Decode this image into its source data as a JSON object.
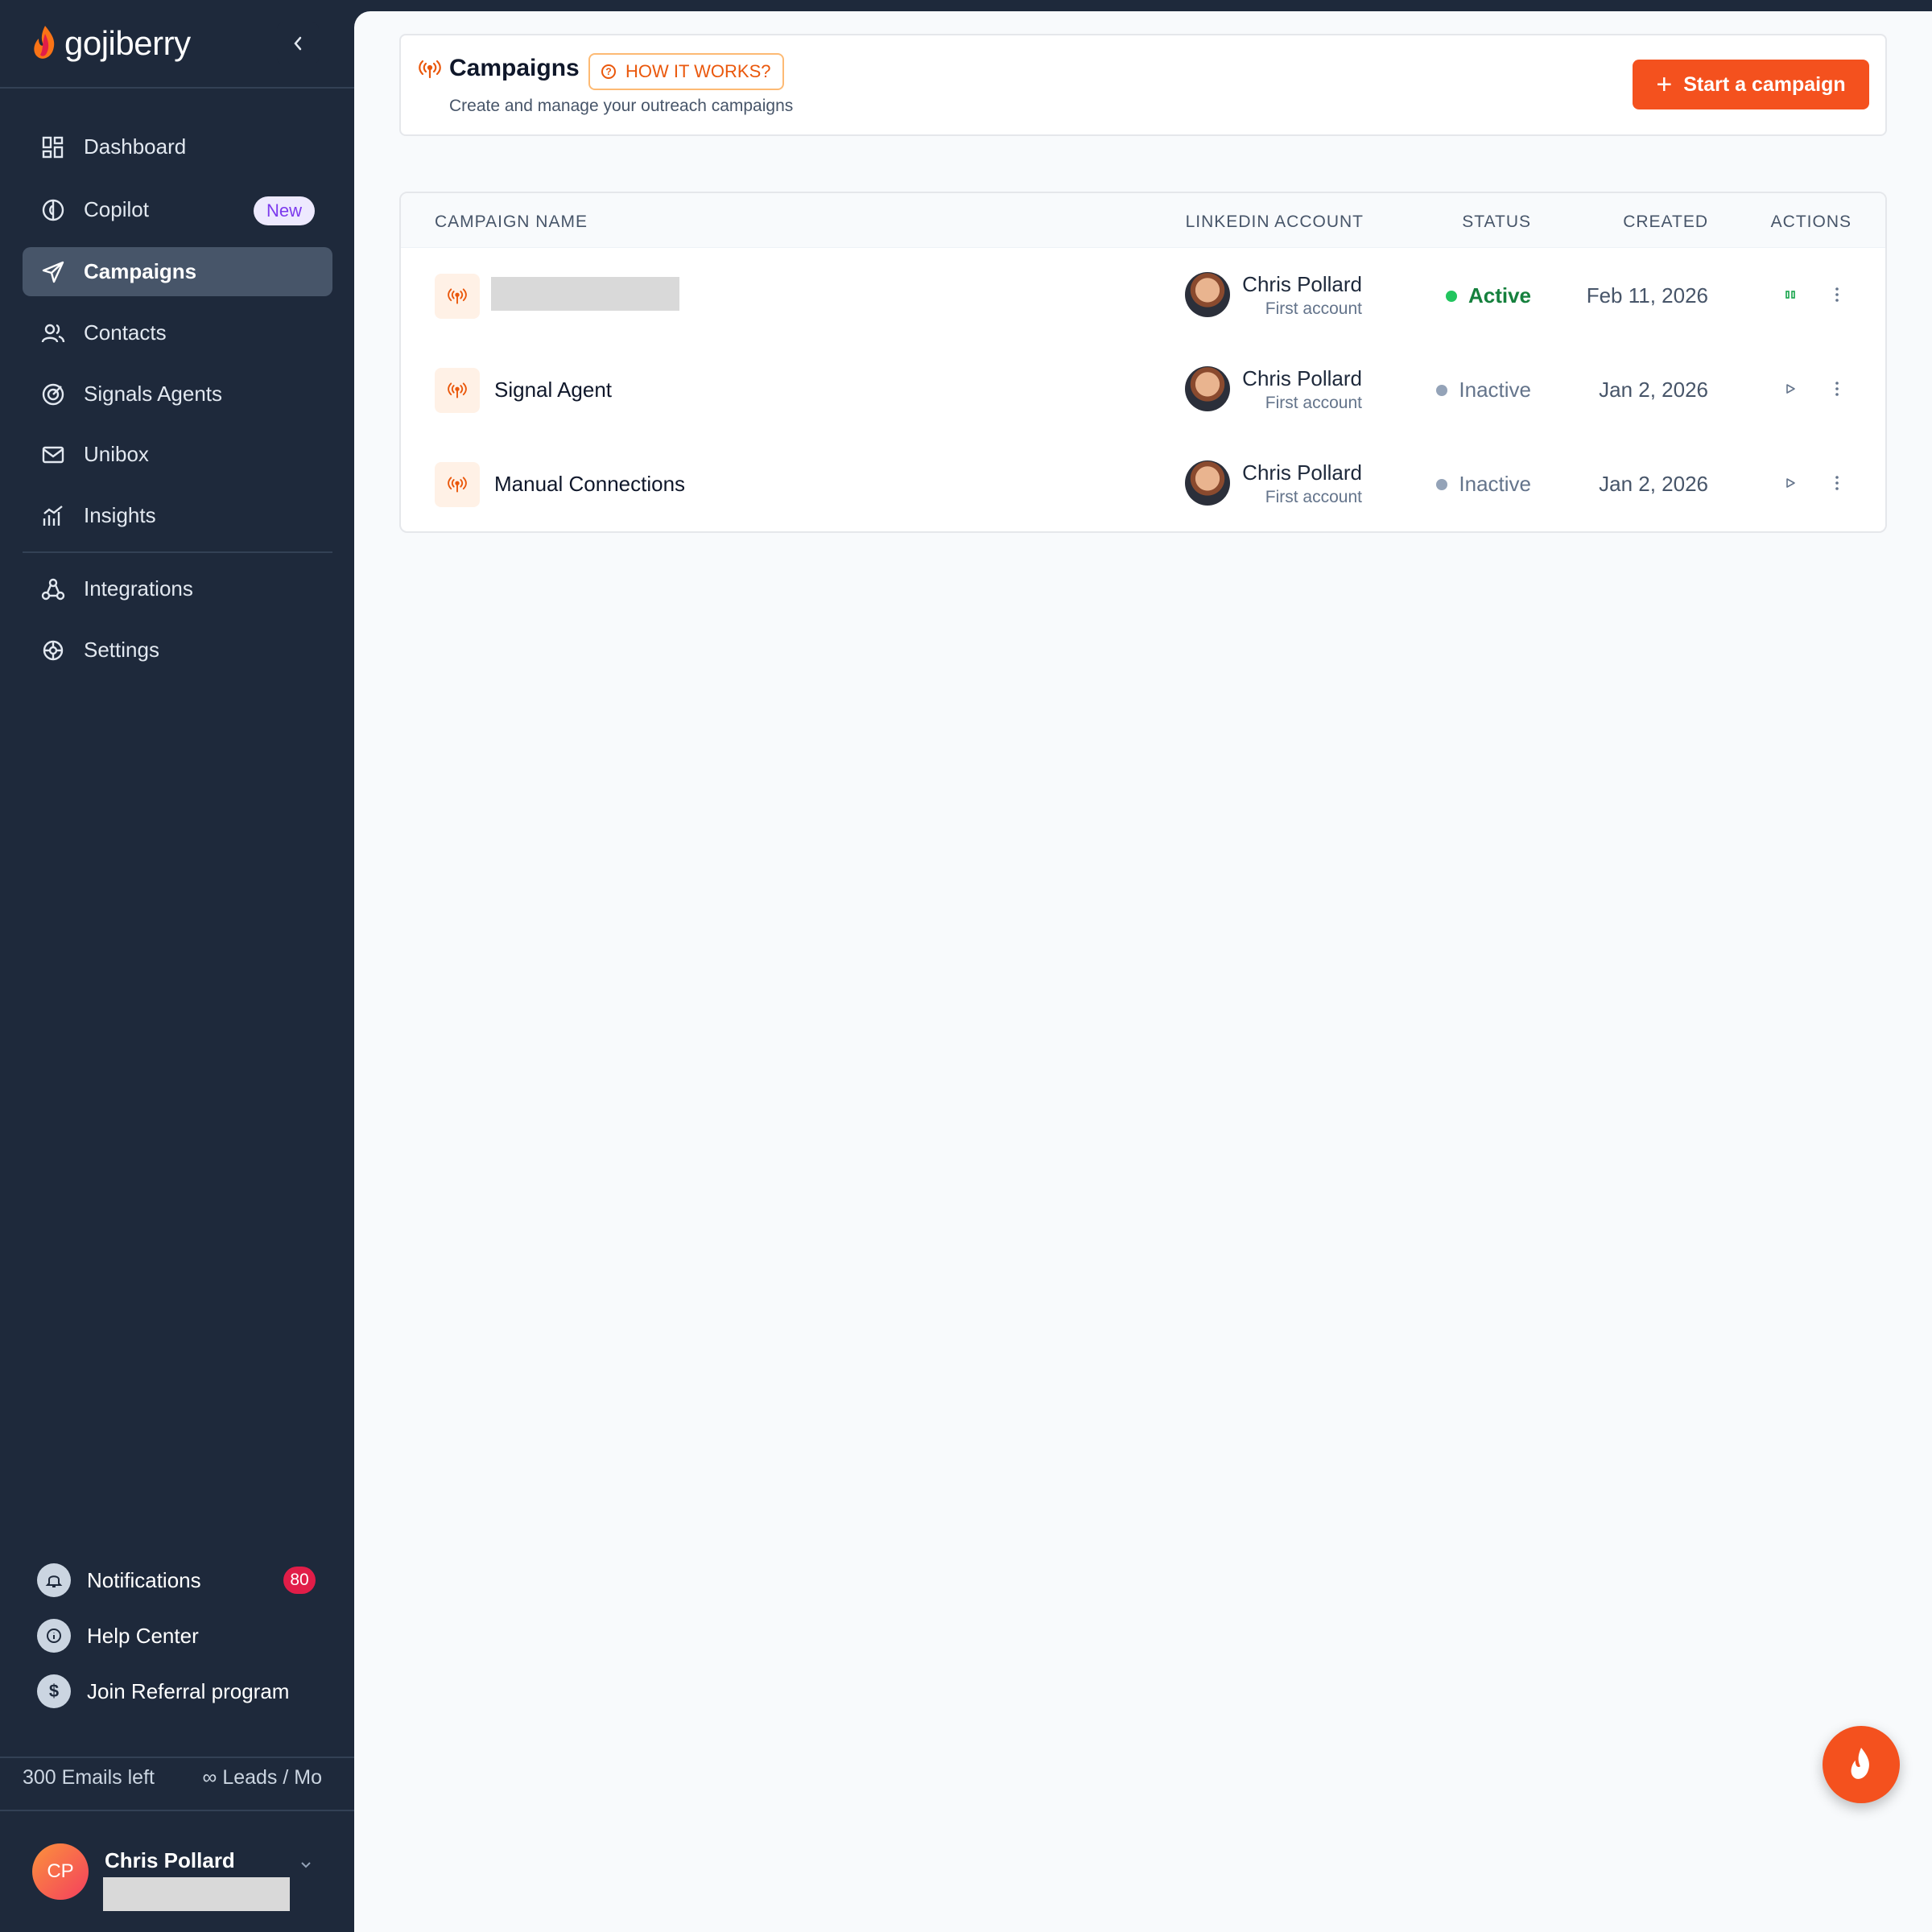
{
  "app": {
    "name": "gojiberry"
  },
  "sidebar": {
    "nav": [
      {
        "label": "Dashboard",
        "icon": "grid-icon"
      },
      {
        "label": "Copilot",
        "icon": "brain-icon",
        "badge": "New"
      },
      {
        "label": "Campaigns",
        "icon": "send-icon",
        "active": true
      },
      {
        "label": "Contacts",
        "icon": "users-icon"
      },
      {
        "label": "Signals Agents",
        "icon": "target-icon"
      },
      {
        "label": "Unibox",
        "icon": "mail-icon"
      },
      {
        "label": "Insights",
        "icon": "chart-icon"
      }
    ],
    "secondary": [
      {
        "label": "Integrations",
        "icon": "integrations-icon"
      },
      {
        "label": "Settings",
        "icon": "settings-icon"
      }
    ],
    "bottom": {
      "notifications": {
        "label": "Notifications",
        "count": "80"
      },
      "help": {
        "label": "Help Center"
      },
      "referral": {
        "label": "Join Referral program"
      }
    },
    "usage": {
      "emails": "300 Emails left",
      "leads": "∞ Leads / Mo"
    },
    "user": {
      "initials": "CP",
      "name": "Chris Pollard"
    }
  },
  "header": {
    "title": "Campaigns",
    "how_label": "HOW IT WORKS?",
    "subtitle": "Create and manage your outreach campaigns",
    "start_label": "Start a campaign"
  },
  "table": {
    "columns": {
      "name": "CAMPAIGN NAME",
      "account": "LINKEDIN ACCOUNT",
      "status": "STATUS",
      "created": "CREATED",
      "actions": "ACTIONS"
    },
    "rows": [
      {
        "name": "",
        "account_name": "Chris Pollard",
        "account_sub": "First account",
        "status": "Active",
        "created": "Feb 11, 2026",
        "action": "pause-icon"
      },
      {
        "name": "Signal Agent",
        "account_name": "Chris Pollard",
        "account_sub": "First account",
        "status": "Inactive",
        "created": "Jan 2, 2026",
        "action": "play-icon"
      },
      {
        "name": "Manual Connections",
        "account_name": "Chris Pollard",
        "account_sub": "First account",
        "status": "Inactive",
        "created": "Jan 2, 2026",
        "action": "play-icon"
      }
    ]
  },
  "colors": {
    "accent": "#f4511e",
    "sidebar_bg": "#1e293b",
    "active_status": "#15803d"
  }
}
